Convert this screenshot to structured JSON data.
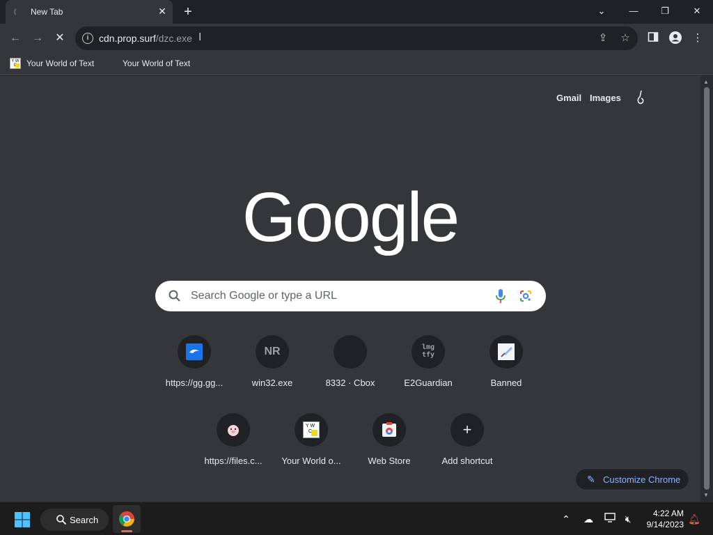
{
  "browser": {
    "tab_title": "New Tab",
    "url_host": "cdn.prop.surf",
    "url_path": "/dzc.exe",
    "bookmarks": [
      {
        "label": "Your World of Text",
        "icon": "yw-favicon"
      },
      {
        "label": "Your World of Text"
      }
    ]
  },
  "page": {
    "top_links": {
      "gmail": "Gmail",
      "images": "Images"
    },
    "logo": "Google",
    "search_placeholder": "Search Google or type a URL",
    "shortcuts": [
      {
        "label": "https://gg.gg...",
        "icon": "gg-favicon"
      },
      {
        "label": "win32.exe",
        "icon_text": "NR"
      },
      {
        "label": "8332 · Cbox",
        "icon": "blank-favicon"
      },
      {
        "label": "E2Guardian",
        "icon_text": "lmg tfy"
      },
      {
        "label": "Banned",
        "icon": "sword-favicon"
      },
      {
        "label": "https://files.c...",
        "icon": "pig-favicon"
      },
      {
        "label": "Your World o...",
        "icon": "yw-favicon"
      },
      {
        "label": "Web Store",
        "icon": "webstore-favicon"
      },
      {
        "label": "Add shortcut",
        "icon": "plus-icon"
      }
    ],
    "customize_label": "Customize Chrome"
  },
  "taskbar": {
    "search_label": "Search",
    "time": "4:22 AM",
    "date": "9/14/2023"
  },
  "colors": {
    "page_bg": "#35363a",
    "accent": "#8ab4f8",
    "notification": "#e8694a"
  }
}
